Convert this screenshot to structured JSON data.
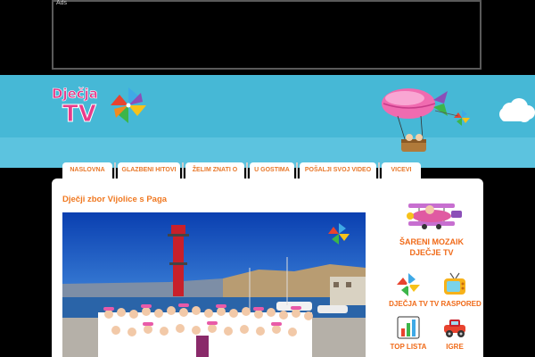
{
  "ad": {
    "label": "Ads"
  },
  "logo": {
    "text_line1": "Dječja",
    "text_line2": "TV"
  },
  "nav": {
    "items": [
      {
        "label": "NASLOVNA"
      },
      {
        "label": "GLAZBENI HITOVI"
      },
      {
        "label": "ŽELIM ZNATI O"
      },
      {
        "label": "U GOSTIMA"
      },
      {
        "label": "POŠALJI SVOJ VIDEO"
      },
      {
        "label": "VICEVI"
      }
    ]
  },
  "article": {
    "title": "Dječji zbor Vijolice s Paga"
  },
  "sidebar": {
    "mozaik": {
      "line1": "ŠARENI MOZAIK",
      "line2": "DJEČJE TV"
    },
    "items": [
      {
        "label": "DJEČJA TV",
        "icon": "pinwheel-icon"
      },
      {
        "label": "TV RASPORED",
        "icon": "tv-icon"
      },
      {
        "label": "TOP LISTA",
        "icon": "chart-icon"
      },
      {
        "label": "IGRE",
        "icon": "toy-car-icon"
      }
    ]
  },
  "colors": {
    "header_sky": "#46b8d6",
    "accent_orange": "#f07820",
    "nav_text": "#e8782a"
  }
}
